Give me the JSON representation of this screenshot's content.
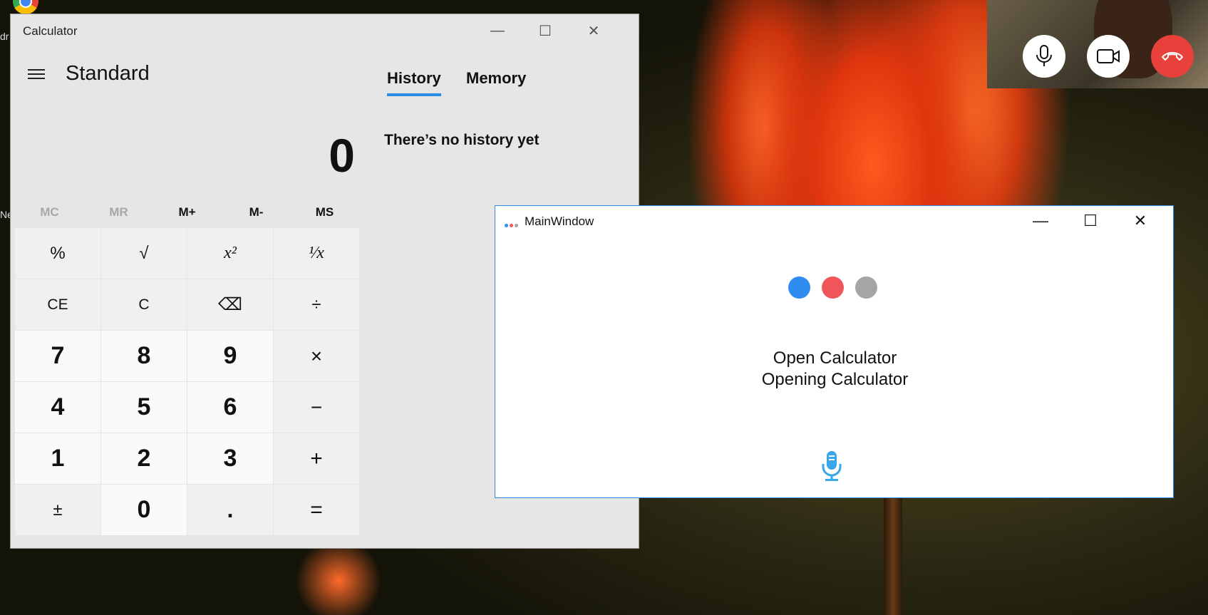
{
  "desktop": {
    "left_text_1": "dr",
    "left_text_2": "Ne"
  },
  "calculator": {
    "window_title": "Calculator",
    "mode": "Standard",
    "tabs": [
      "History",
      "Memory"
    ],
    "active_tab": "History",
    "display_value": "0",
    "history_empty_text": "There’s no history yet",
    "memory_buttons": [
      {
        "label": "MC",
        "enabled": false
      },
      {
        "label": "MR",
        "enabled": false
      },
      {
        "label": "M+",
        "enabled": true
      },
      {
        "label": "M-",
        "enabled": true
      },
      {
        "label": "MS",
        "enabled": true
      }
    ],
    "keys": [
      [
        "%",
        "√",
        "x²",
        "¹⁄x"
      ],
      [
        "CE",
        "C",
        "⌫",
        "÷"
      ],
      [
        "7",
        "8",
        "9",
        "×"
      ],
      [
        "4",
        "5",
        "6",
        "−"
      ],
      [
        "1",
        "2",
        "3",
        "+"
      ],
      [
        "±",
        "0",
        ".",
        "="
      ]
    ]
  },
  "main_window": {
    "title": "MainWindow",
    "dot_colors": [
      "#2f8cf0",
      "#f0555a",
      "#a5a5a5"
    ],
    "command_text": "Open Calculator",
    "response_text": "Opening Calculator",
    "mic_color": "#37a6ea"
  },
  "video_call": {
    "controls": [
      "microphone-icon",
      "video-camera-icon",
      "hang-up-icon"
    ],
    "hangup_color": "#e8413b"
  }
}
